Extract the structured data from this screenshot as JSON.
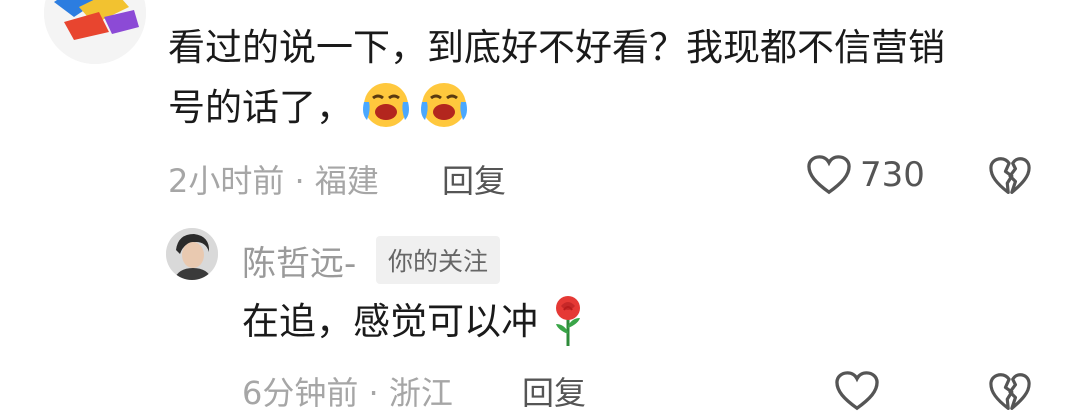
{
  "comment": {
    "text_line1": "看过的说一下，到底好不好看？我现都不信营销",
    "text_line2": "号的话了，",
    "emojis": [
      "laughing-crying-emoji",
      "laughing-crying-emoji"
    ],
    "time": "2小时前",
    "separator": " · ",
    "location": "福建",
    "reply_label": "回复",
    "like_count": "730"
  },
  "reply": {
    "author": "陈哲远-",
    "badge": "你的关注",
    "text": "在追，感觉可以冲",
    "emoji": "rose-emoji",
    "time": "6分钟前",
    "separator": " · ",
    "location": "浙江",
    "reply_label": "回复"
  },
  "colors": {
    "meta_gray": "#a6a6a6",
    "text": "#1a1a1a",
    "badge_bg": "#f0f0f0"
  }
}
